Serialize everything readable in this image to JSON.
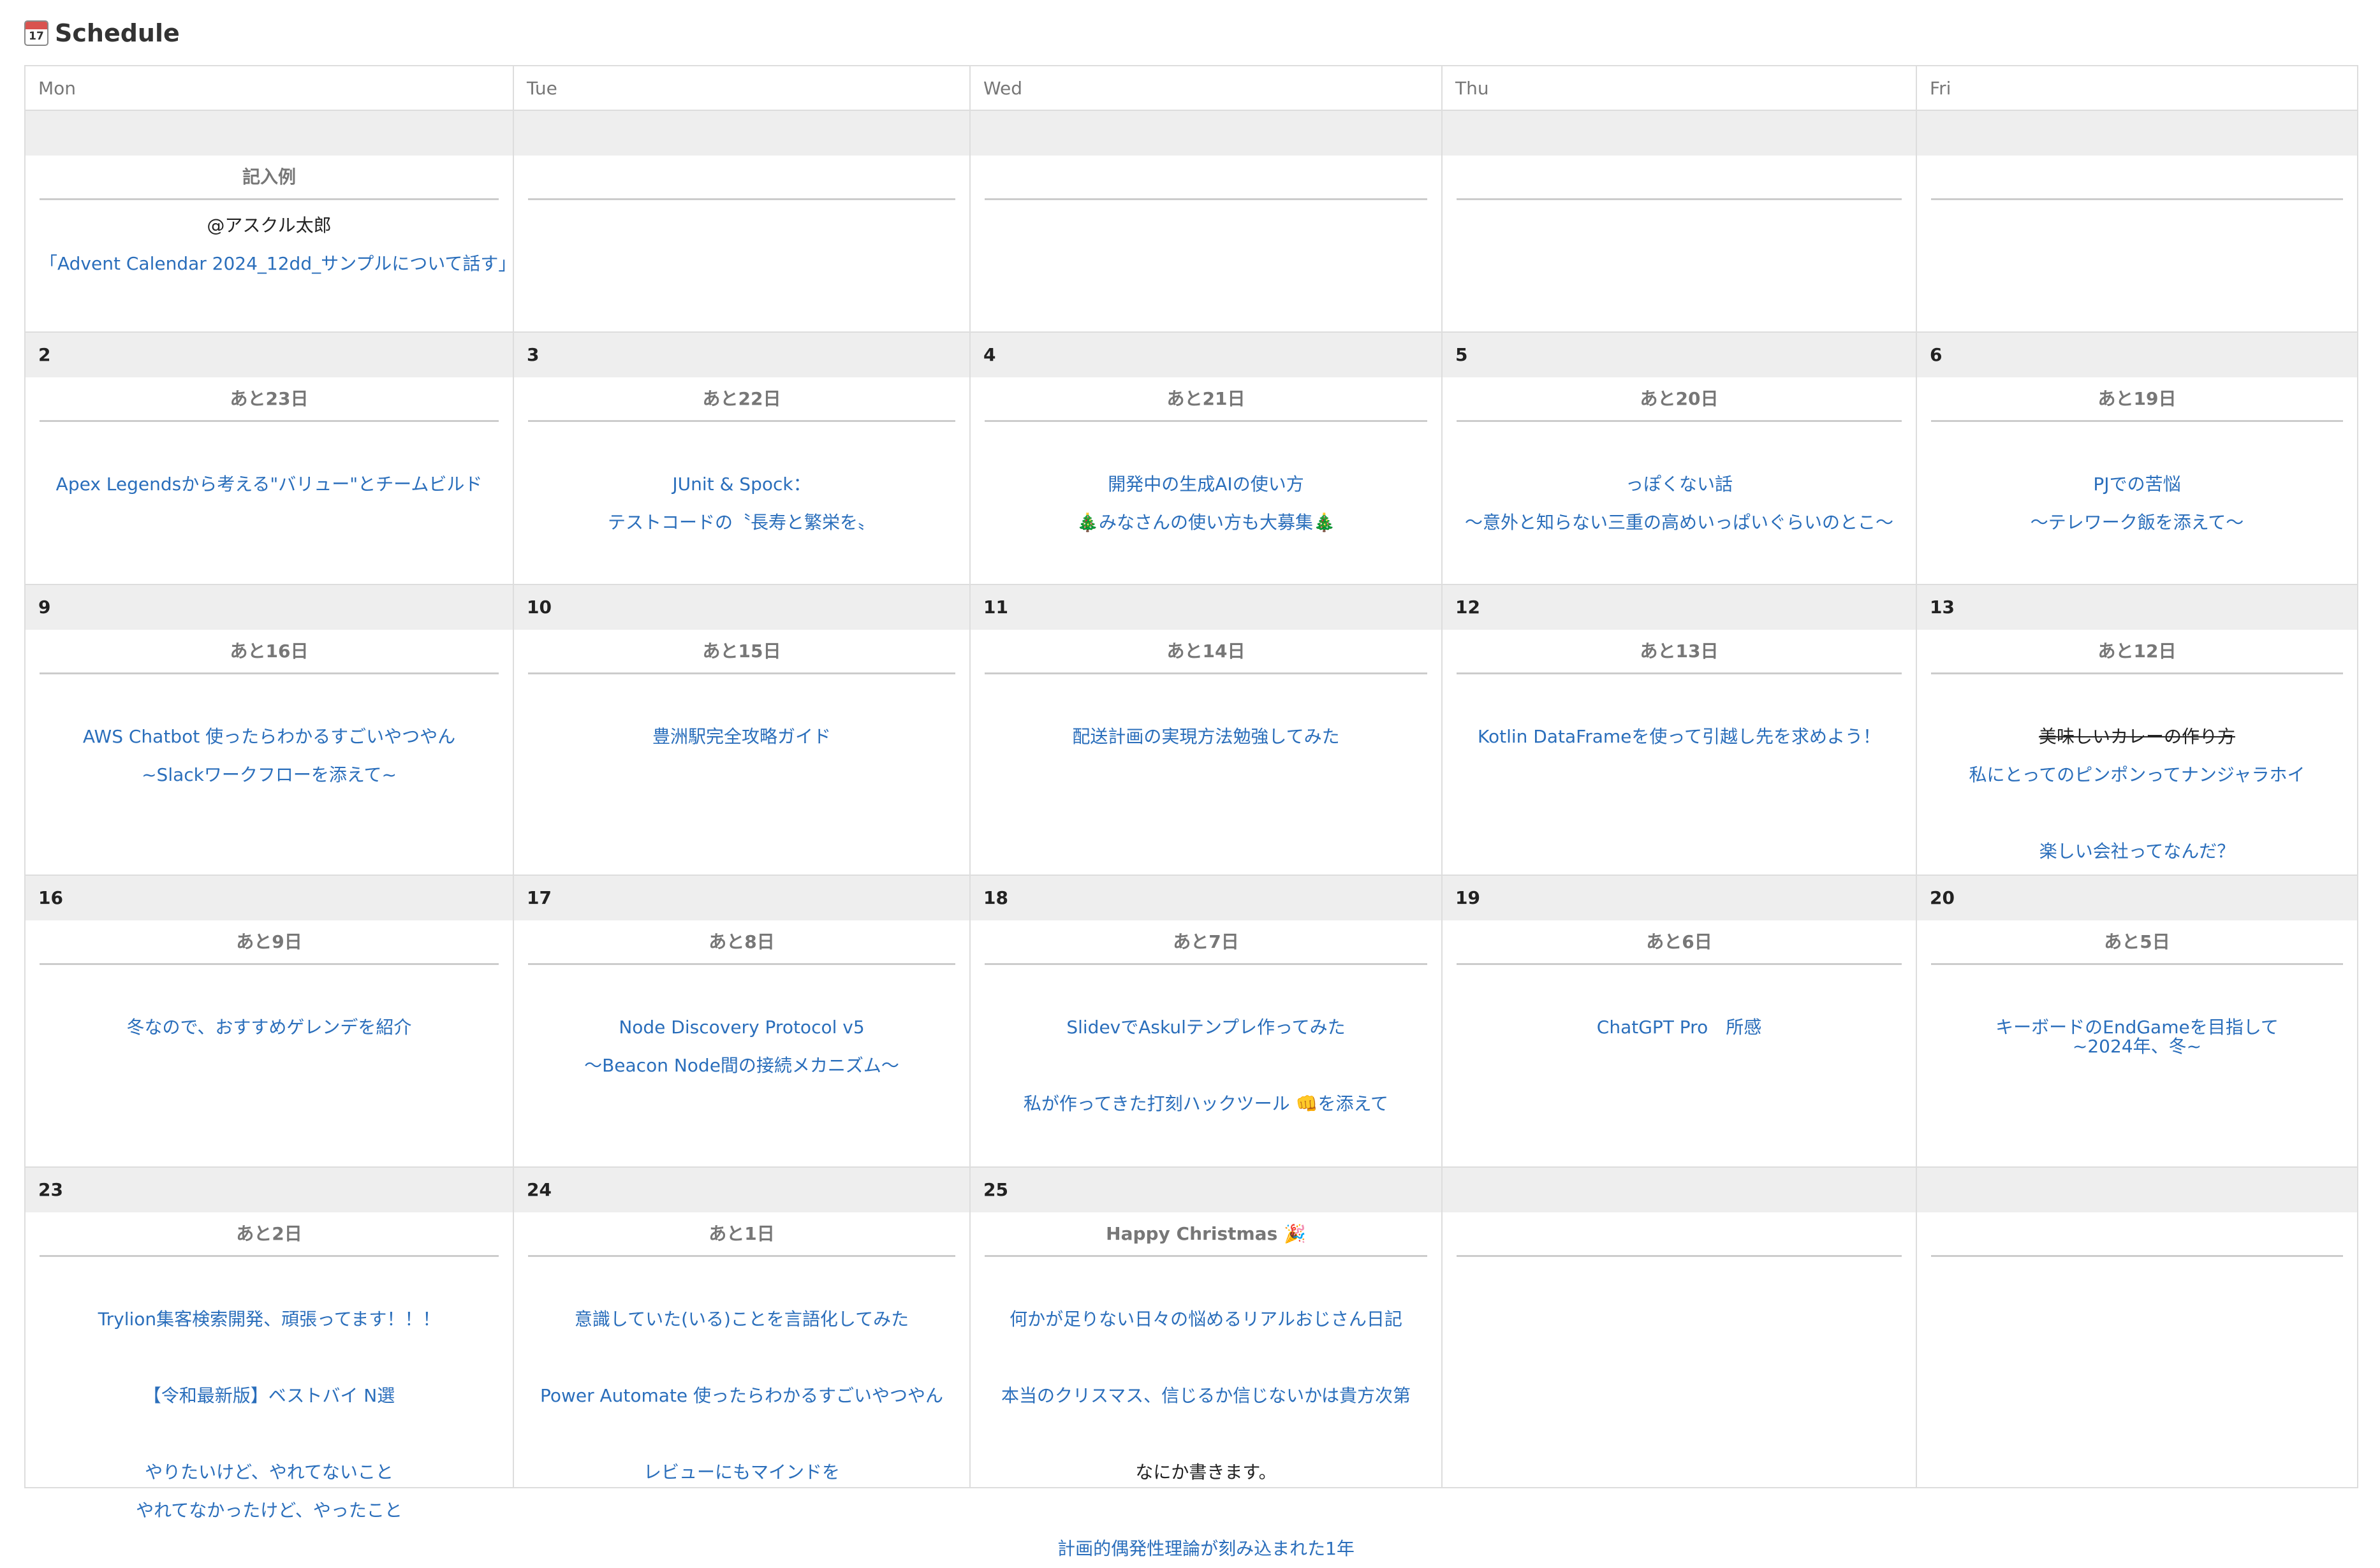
{
  "title": "Schedule",
  "title_icon": "calendar-icon",
  "title_icon_day": "17",
  "colors": {
    "link": "#2a6ebb",
    "muted": "#777777",
    "border": "#dddddd",
    "date_bar": "#eeeeee"
  },
  "weekdays": [
    "Mon",
    "Tue",
    "Wed",
    "Thu",
    "Fri"
  ],
  "rows": [
    {
      "days": [
        {
          "date": "",
          "countdown": "記入例",
          "entries": [
            {
              "text": "@アスクル太郎",
              "style": "plain"
            },
            {
              "text": "「Advent Calendar 2024_12dd_サンプルについて話す」",
              "style": "link"
            }
          ]
        },
        {
          "date": "",
          "countdown": "",
          "entries": []
        },
        {
          "date": "",
          "countdown": "",
          "entries": []
        },
        {
          "date": "",
          "countdown": "",
          "entries": []
        },
        {
          "date": "",
          "countdown": "",
          "entries": []
        }
      ]
    },
    {
      "days": [
        {
          "date": "2",
          "countdown": "あと23日",
          "entries": [
            {
              "text": "Apex Legendsから考える\"バリュー\"とチームビルド",
              "style": "link"
            }
          ]
        },
        {
          "date": "3",
          "countdown": "あと22日",
          "entries": [
            {
              "text": "JUnit & Spock：",
              "style": "link"
            },
            {
              "text": "テストコードの〝長寿と繁栄を〟",
              "style": "link"
            }
          ]
        },
        {
          "date": "4",
          "countdown": "あと21日",
          "entries": [
            {
              "text": "開発中の生成AIの使い方",
              "style": "link"
            },
            {
              "text": "🎄みなさんの使い方も大募集🎄",
              "style": "link"
            }
          ]
        },
        {
          "date": "5",
          "countdown": "あと20日",
          "entries": [
            {
              "text": "っぽくない話",
              "style": "link"
            },
            {
              "text": "〜意外と知らない三重の高めいっぱいぐらいのとこ〜",
              "style": "link"
            }
          ]
        },
        {
          "date": "6",
          "countdown": "あと19日",
          "entries": [
            {
              "text": "PJでの苦悩",
              "style": "link"
            },
            {
              "text": "〜テレワーク飯を添えて〜",
              "style": "link"
            }
          ]
        }
      ]
    },
    {
      "days": [
        {
          "date": "9",
          "countdown": "あと16日",
          "entries": [
            {
              "text": "AWS Chatbot 使ったらわかるすごいやつやん",
              "style": "link"
            },
            {
              "text": "~Slackワークフローを添えて~",
              "style": "link"
            }
          ]
        },
        {
          "date": "10",
          "countdown": "あと15日",
          "entries": [
            {
              "text": "豊洲駅完全攻略ガイド",
              "style": "link"
            }
          ]
        },
        {
          "date": "11",
          "countdown": "あと14日",
          "entries": [
            {
              "text": "配送計画の実現方法勉強してみた",
              "style": "link"
            }
          ]
        },
        {
          "date": "12",
          "countdown": "あと13日",
          "entries": [
            {
              "text": "Kotlin DataFrameを使って引越し先を求めよう！",
              "style": "link"
            }
          ]
        },
        {
          "date": "13",
          "countdown": "あと12日",
          "entries": [
            {
              "text": "美味しいカレーの作り方",
              "style": "strike"
            },
            {
              "text": "私にとってのピンポンってナンジャラホイ",
              "style": "link"
            },
            {
              "text": "",
              "style": "link"
            },
            {
              "text": "楽しい会社ってなんだ？",
              "style": "link"
            }
          ]
        }
      ]
    },
    {
      "days": [
        {
          "date": "16",
          "countdown": "あと9日",
          "entries": [
            {
              "text": "冬なので、おすすめゲレンデを紹介",
              "style": "link"
            }
          ]
        },
        {
          "date": "17",
          "countdown": "あと8日",
          "entries": [
            {
              "text": "Node Discovery Protocol v5",
              "style": "link"
            },
            {
              "text": "〜Beacon Node間の接続メカニズム〜",
              "style": "link"
            }
          ]
        },
        {
          "date": "18",
          "countdown": "あと7日",
          "entries": [
            {
              "text": "SlidevでAskulテンプレ作ってみた",
              "style": "link"
            },
            {
              "text": "",
              "style": "link"
            },
            {
              "text": "私が作ってきた打刻ハックツール 👊を添えて",
              "style": "link"
            }
          ]
        },
        {
          "date": "19",
          "countdown": "あと6日",
          "entries": [
            {
              "text": "ChatGPT Pro　所感",
              "style": "link"
            }
          ]
        },
        {
          "date": "20",
          "countdown": "あと5日",
          "entries": [
            {
              "text": "キーボードのEndGameを目指して",
              "style": "link"
            },
            {
              "text": "~2024年、冬~",
              "style": "link-tight"
            }
          ]
        }
      ]
    },
    {
      "days": [
        {
          "date": "23",
          "countdown": "あと2日",
          "entries": [
            {
              "text": "Trylion集客検索開発、頑張ってます！！！",
              "style": "link"
            },
            {
              "text": "",
              "style": "link"
            },
            {
              "text": "【令和最新版】ベストバイ N選",
              "style": "link"
            },
            {
              "text": "",
              "style": "link"
            },
            {
              "text": "やりたいけど、やれてないこと",
              "style": "link"
            },
            {
              "text": "やれてなかったけど、やったこと",
              "style": "link"
            }
          ]
        },
        {
          "date": "24",
          "countdown": "あと1日",
          "entries": [
            {
              "text": "意識していた(いる)ことを言語化してみた",
              "style": "link"
            },
            {
              "text": "",
              "style": "link"
            },
            {
              "text": "Power Automate 使ったらわかるすごいやつやん",
              "style": "link"
            },
            {
              "text": "",
              "style": "link"
            },
            {
              "text": "レビューにもマインドを",
              "style": "link"
            }
          ]
        },
        {
          "date": "25",
          "countdown": "Happy Christmas 🎉",
          "entries": [
            {
              "text": "何かが足りない日々の悩めるリアルおじさん日記",
              "style": "link"
            },
            {
              "text": "",
              "style": "link"
            },
            {
              "text": "本当のクリスマス、信じるか信じないかは貴方次第",
              "style": "link"
            },
            {
              "text": "",
              "style": "link"
            },
            {
              "text": "なにか書きます。",
              "style": "plain"
            },
            {
              "text": "",
              "style": "link"
            },
            {
              "text": "計画的偶発性理論が刻み込まれた1年",
              "style": "link"
            }
          ]
        },
        {
          "date": "",
          "countdown": "",
          "entries": []
        },
        {
          "date": "",
          "countdown": "",
          "entries": []
        }
      ]
    }
  ]
}
